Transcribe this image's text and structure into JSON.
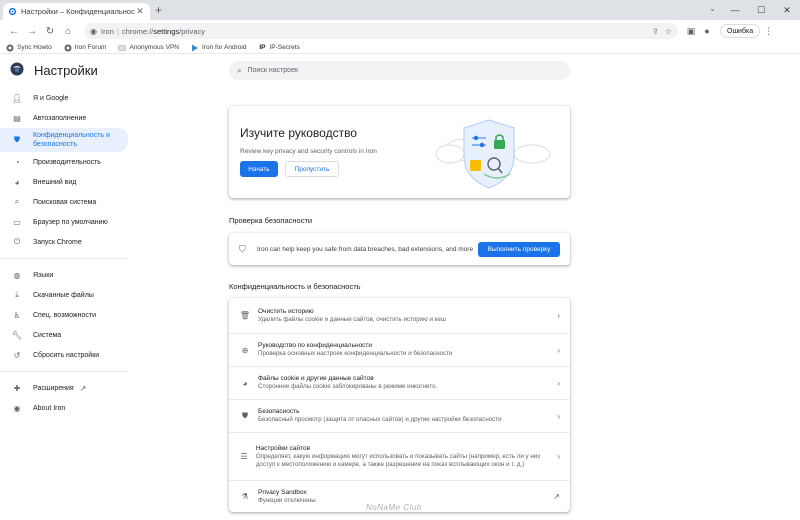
{
  "browser": {
    "tab_title": "Настройки – Конфиденциальнос",
    "newtab": "+",
    "omnibox": {
      "site_name": "Iron",
      "separator": "|",
      "url_scheme": "chrome://",
      "url_host": "settings",
      "url_path": "/privacy"
    },
    "error_chip": "Ошибка",
    "bookmarks": [
      {
        "label": "Sync Howto"
      },
      {
        "label": "Iron Forum"
      },
      {
        "label": "Anonymous VPN"
      },
      {
        "label": "Iron for Android"
      },
      {
        "label": "IP-Secrets"
      }
    ]
  },
  "settings": {
    "title": "Настройки",
    "search_placeholder": "Поиск настроек",
    "sidebar": {
      "group1": [
        {
          "label": "Я и Google",
          "icon": "person-icon"
        },
        {
          "label": "Автозаполнение",
          "icon": "autofill-icon"
        },
        {
          "label": "Конфиденциальность и безопасность",
          "icon": "shield-icon",
          "active": true
        },
        {
          "label": "Производительность",
          "icon": "speedometer-icon"
        },
        {
          "label": "Внешний вид",
          "icon": "palette-icon"
        },
        {
          "label": "Поисковая система",
          "icon": "search-icon"
        },
        {
          "label": "Браузер по умолчанию",
          "icon": "browser-icon"
        },
        {
          "label": "Запуск Chrome",
          "icon": "power-icon"
        }
      ],
      "group2": [
        {
          "label": "Языки",
          "icon": "globe-icon"
        },
        {
          "label": "Скачанные файлы",
          "icon": "download-icon"
        },
        {
          "label": "Спец. возможности",
          "icon": "accessibility-icon"
        },
        {
          "label": "Система",
          "icon": "wrench-icon"
        },
        {
          "label": "Сбросить настройки",
          "icon": "reset-icon"
        }
      ],
      "group3": [
        {
          "label": "Расширения",
          "icon": "puzzle-icon"
        },
        {
          "label": "About Iron",
          "icon": "iron-logo-icon"
        }
      ]
    },
    "guide": {
      "title": "Изучите руководство",
      "subtitle": "Review key privacy and security controls in Iron",
      "start_label": "Начать",
      "skip_label": "Пропустить"
    },
    "safety": {
      "section_title": "Проверка безопасности",
      "text": "Iron can help keep you safe from data breaches, bad extensions, and more",
      "button_label": "Выполнить проверку"
    },
    "privacy": {
      "section_title": "Конфиденциальность и безопасность",
      "rows": [
        {
          "title": "Очистить историю",
          "desc": "Удалить файлы cookie и данные сайтов, очистить историю и кеш",
          "icon": "trash-icon"
        },
        {
          "title": "Руководство по конфиденциальности",
          "desc": "Проверка основных настроек конфиденциальности и безопасности",
          "icon": "compass-icon"
        },
        {
          "title": "Файлы cookie и другие данные сайтов",
          "desc": "Сторонние файлы cookie заблокированы в режиме инкогнито.",
          "icon": "cookie-icon"
        },
        {
          "title": "Безопасность",
          "desc": "Безопасный просмотр (защита от опасных сайтов) и другие настройки безопасности",
          "icon": "security-shield-icon"
        },
        {
          "title": "Настройки сайтов",
          "desc": "Определяет, какую информацию могут использовать и показывать сайты (например, есть ли у них доступ к местоположению и камере, а также разрешение на показ всплывающих окон и т. д.)",
          "icon": "sliders-icon"
        },
        {
          "title": "Privacy Sandbox",
          "desc": "Функции отключены",
          "icon": "flask-icon"
        }
      ]
    }
  },
  "watermark": "NoNaMe Club"
}
